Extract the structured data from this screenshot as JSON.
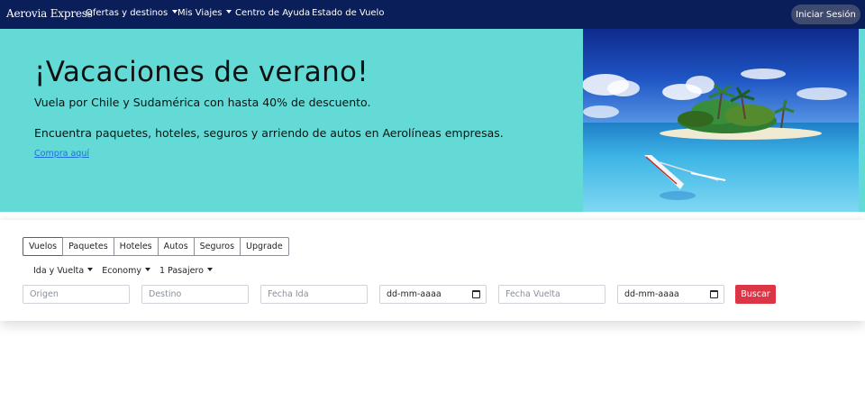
{
  "navbar": {
    "brand": "Aerovia Express",
    "items": [
      {
        "label": "Ofertas y destinos",
        "dropdown": true
      },
      {
        "label": "Mis Viajes",
        "dropdown": true
      },
      {
        "label": "Centro de Ayuda",
        "dropdown": false
      },
      {
        "label": "Estado de Vuelo",
        "dropdown": false
      }
    ],
    "login_label": "Iniciar Sesión"
  },
  "hero": {
    "title": "¡Vacaciones de verano!",
    "subtitle": "Vuela por Chile y Sudamérica con hasta 40% de descuento.",
    "text": "Encuentra paquetes, hoteles, seguros y arriendo de autos en Aerolíneas empresas.",
    "link": "Compra aquí"
  },
  "search": {
    "tabs": [
      "Vuelos",
      "Paquetes",
      "Hoteles",
      "Autos",
      "Seguros",
      "Upgrade"
    ],
    "active_tab": "Vuelos",
    "trip_type": "Ida y Vuelta",
    "cabin": "Economy",
    "passengers": "1 Pasajero",
    "origin_placeholder": "Origen",
    "destination_placeholder": "Destino",
    "departure_placeholder": "Fecha Ida",
    "departure_date_value": "dd-mm-aaaa",
    "return_placeholder": "Fecha Vuelta",
    "return_date_value": "dd-mm-aaaa",
    "search_label": "Buscar"
  },
  "colors": {
    "navbar_bg": "#0a1f5a",
    "hero_bg": "#63dad5",
    "search_button": "#dc3545",
    "link": "#1d6fd8"
  }
}
